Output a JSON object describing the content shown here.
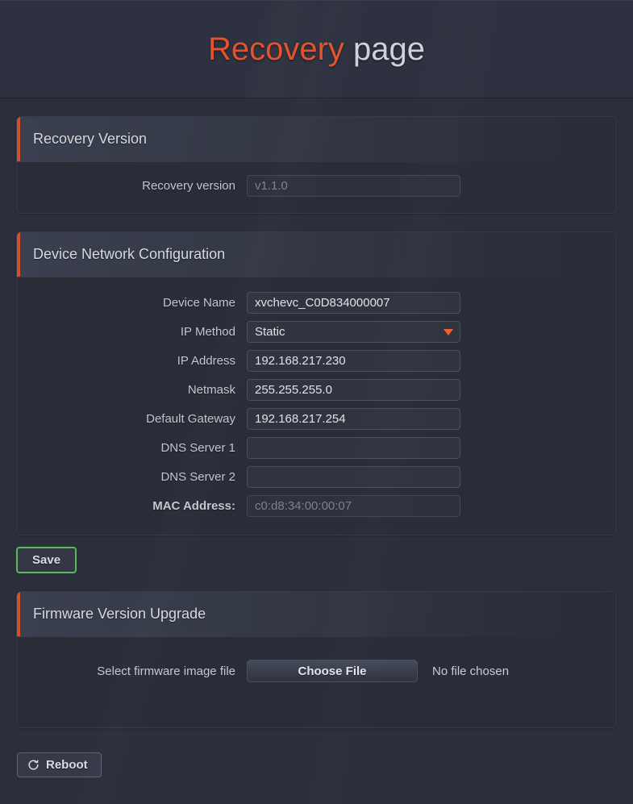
{
  "header": {
    "title_accent": "Recovery",
    "title_rest": "page"
  },
  "theme": {
    "accent": "#e4532c",
    "panel_accent_bar": "#d2512c",
    "save_border": "#5cb85c",
    "caret": "#f0632e",
    "background": "#2b2f3b",
    "panel_bg": "#2a2d38"
  },
  "panels": {
    "recovery_version": {
      "title": "Recovery Version",
      "rows": [
        {
          "label": "Recovery version",
          "value": "v1.1.0",
          "readonly": true
        }
      ]
    },
    "device_network": {
      "title": "Device Network Configuration",
      "rows": [
        {
          "label": "Device Name",
          "value": "xvchevc_C0D834000007",
          "type": "text"
        },
        {
          "label": "IP Method",
          "value": "Static",
          "type": "select"
        },
        {
          "label": "IP Address",
          "value": "192.168.217.230",
          "type": "text"
        },
        {
          "label": "Netmask",
          "value": "255.255.255.0",
          "type": "text"
        },
        {
          "label": "Default Gateway",
          "value": "192.168.217.254",
          "type": "text"
        },
        {
          "label": "DNS Server 1",
          "value": "",
          "type": "text"
        },
        {
          "label": "DNS Server 2",
          "value": "",
          "type": "text"
        },
        {
          "label": "MAC Address:",
          "value": "c0:d8:34:00:00:07",
          "type": "text",
          "readonly": true
        }
      ]
    },
    "firmware_upgrade": {
      "title": "Firmware Version Upgrade",
      "file_label": "Select firmware image file",
      "choose_button": "Choose File",
      "file_status": "No file chosen"
    }
  },
  "buttons": {
    "save": "Save",
    "reboot": "Reboot"
  },
  "icons": {
    "ip_method_caret": "chevron-down-icon",
    "reboot": "refresh-circular-arrow-icon"
  }
}
